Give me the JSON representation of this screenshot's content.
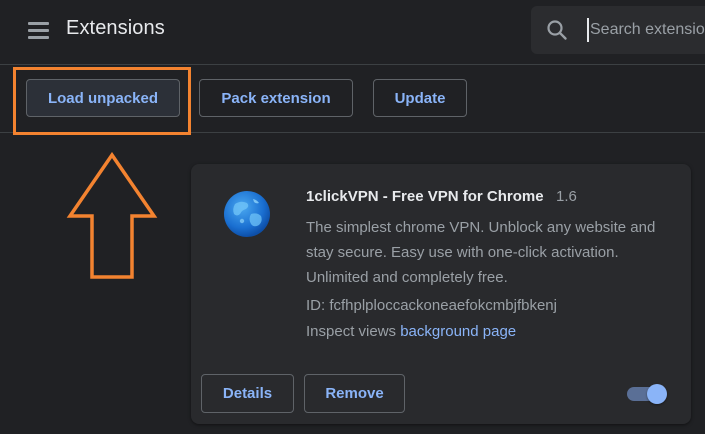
{
  "header": {
    "title": "Extensions",
    "search_placeholder": "Search extensions"
  },
  "toolbar": {
    "load_unpacked_label": "Load unpacked",
    "pack_extension_label": "Pack extension",
    "update_label": "Update"
  },
  "annotation": {
    "color": "#f38330",
    "highlight_target": "Load unpacked",
    "arrow_direction": "up"
  },
  "extension": {
    "name": "1clickVPN - Free VPN for Chrome",
    "version": "1.6",
    "description": "The simplest chrome VPN. Unblock any website and stay secure. Easy use with one-click activation. Unlimited and completely free.",
    "id_label": "ID: fcfhplploccackoneaefokcmbjfbkenj",
    "inspect_label": "Inspect views",
    "inspect_link": "background page",
    "details_label": "Details",
    "remove_label": "Remove",
    "enabled": true,
    "icon": "globe-icon"
  },
  "colors": {
    "background": "#202124",
    "card": "#292a2d",
    "accent": "#8ab4f8",
    "text": "#e8eaed",
    "secondary_text": "#9aa0a6"
  }
}
